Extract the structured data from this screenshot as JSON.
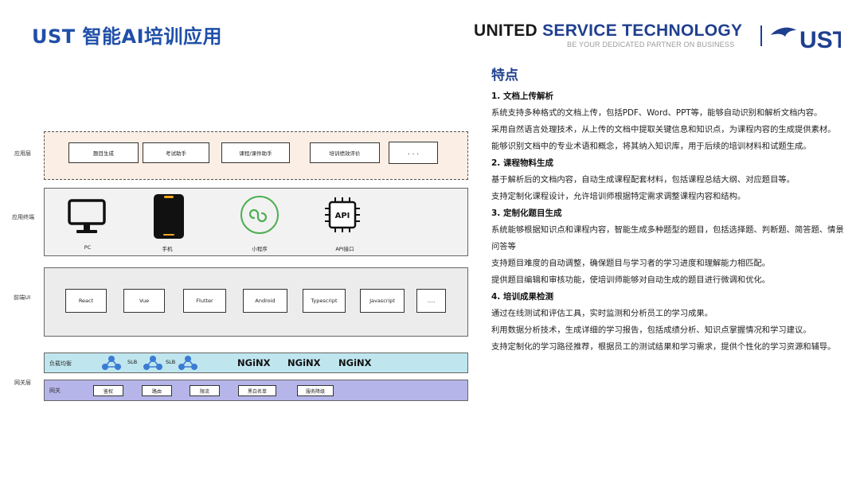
{
  "header": {
    "title": "UST 智能AI培训应用",
    "brand_part1": "UNITED ",
    "brand_part2": "SERVICE TECHNOLOGY",
    "tagline": "BE YOUR DEDICATED PARTNER ON BUSINESS",
    "logo_text": "UST"
  },
  "diagram": {
    "app_layer": {
      "label": "应用层",
      "items": [
        "题目生成",
        "考试助手",
        "课程/课件助手",
        "培训绩效评价",
        ". . ."
      ]
    },
    "terminal_layer": {
      "label": "应用终端",
      "items": [
        {
          "icon": "monitor-icon",
          "label": "PC"
        },
        {
          "icon": "phone-icon",
          "label": "手机"
        },
        {
          "icon": "mini-program-icon",
          "label": "小程序"
        },
        {
          "icon": "api-chip-icon",
          "label": "API接口"
        }
      ]
    },
    "frontend_layer": {
      "label": "前端UI",
      "items": [
        "React",
        "Vue",
        "Flutter",
        "Android",
        "Typescript",
        "Javascript",
        "....."
      ]
    },
    "gateway_layer": {
      "label": "网关层",
      "lb_label": "负载均衡",
      "slb": [
        "SLB",
        "SLB"
      ],
      "nginx": [
        "NGiNX",
        "NGiNX",
        "NGiNX"
      ],
      "gw_label": "网关",
      "gw_items": [
        "鉴权",
        "路由",
        "限流",
        "黑白名单",
        "服务降级"
      ]
    },
    "colors": {
      "app_bg": "#fbeee4",
      "lb_bg": "#bfe6ee",
      "gw_bg": "#b5b5ea",
      "slb_blue": "#3a7bd5",
      "miniprogram_green": "#4caf50"
    }
  },
  "features": {
    "heading": "特点",
    "sections": [
      {
        "title": "1. 文档上传解析",
        "paras": [
          "系统支持多种格式的文档上传，包括PDF、Word、PPT等，能够自动识别和解析文档内容。",
          "采用自然语言处理技术，从上传的文档中提取关键信息和知识点，为课程内容的生成提供素材。",
          "能够识别文档中的专业术语和概念，将其纳入知识库，用于后续的培训材料和试题生成。"
        ]
      },
      {
        "title": "2. 课程物料生成",
        "paras": [
          "基于解析后的文档内容，自动生成课程配套材料，包括课程总结大纲、对应题目等。",
          "支持定制化课程设计，允许培训师根据特定需求调整课程内容和结构。"
        ]
      },
      {
        "title": "3. 定制化题目生成",
        "paras": [
          "系统能够根据知识点和课程内容，智能生成多种题型的题目，包括选择题、判断题、简答题、情景问答等",
          "支持题目难度的自动调整，确保题目与学习者的学习进度和理解能力相匹配。",
          "提供题目编辑和审核功能，使培训师能够对自动生成的题目进行微调和优化。"
        ]
      },
      {
        "title": "4. 培训成果检测",
        "paras": [
          "通过在线测试和评估工具，实时监测和分析员工的学习成果。",
          "利用数据分析技术，生成详细的学习报告，包括成绩分析、知识点掌握情况和学习建议。",
          "支持定制化的学习路径推荐，根据员工的测试结果和学习需求，提供个性化的学习资源和辅导。"
        ]
      }
    ]
  }
}
